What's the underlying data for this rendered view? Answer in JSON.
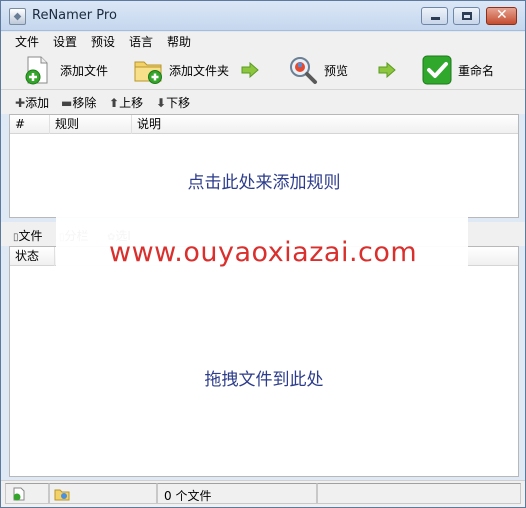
{
  "window": {
    "title": "ReNamer Pro"
  },
  "menu": [
    "文件",
    "设置",
    "预设",
    "语言",
    "帮助"
  ],
  "toolbar": {
    "add_files": "添加文件",
    "add_folders": "添加文件夹",
    "preview": "预览",
    "rename": "重命名"
  },
  "rules_toolbar": {
    "add": "添加",
    "remove": "移除",
    "move_up": "上移",
    "move_down": "下移"
  },
  "rules_table": {
    "columns": [
      "#",
      "规则",
      "说明"
    ],
    "empty_hint": "点击此处来添加规则"
  },
  "files_toolbar": {
    "files": "文件",
    "columns": "分栏",
    "options": "选I"
  },
  "files_table": {
    "columns": [
      "状态"
    ],
    "empty_hint": "拖拽文件到此处"
  },
  "watermark": {
    "text": "www.ouyaoxiazai.com"
  },
  "status": {
    "file_count": "0 个文件"
  },
  "colors": {
    "accent": "#2d3d8b",
    "watermark": "#d9302e",
    "rename_green": "#2fa82c"
  }
}
